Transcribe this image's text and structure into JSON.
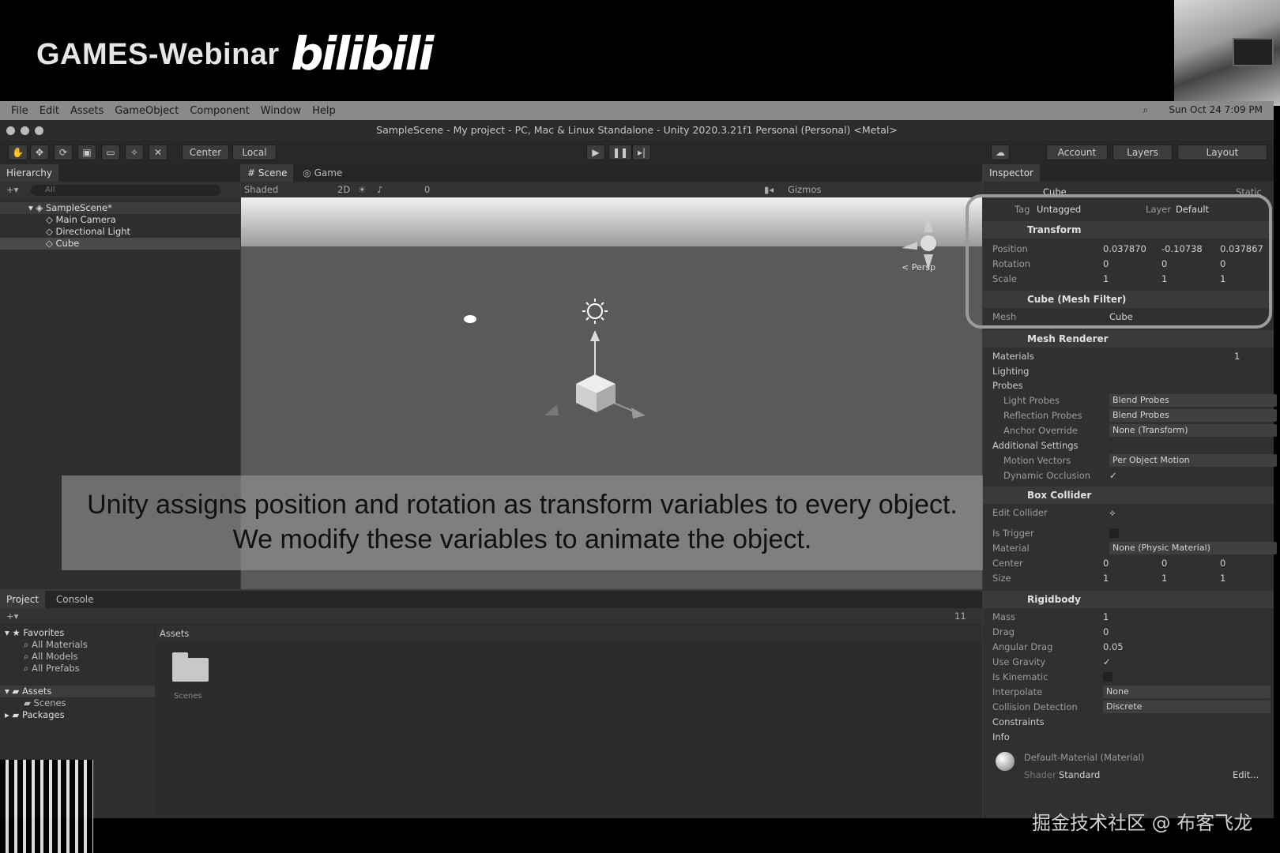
{
  "banner": {
    "brand": "GAMES-Webinar",
    "bili": "bilibili"
  },
  "menu": [
    "File",
    "Edit",
    "Assets",
    "GameObject",
    "Component",
    "Window",
    "Help"
  ],
  "clock": "Sun Oct 24  7:09 PM",
  "window_title": "SampleScene - My project - PC, Mac & Linux Standalone - Unity 2020.3.21f1 Personal (Personal) <Metal>",
  "toolbar": {
    "center": "Center",
    "local": "Local",
    "account": "Account",
    "layers": "Layers",
    "layout": "Layout"
  },
  "hierarchy": {
    "tab": "Hierarchy",
    "search": "All",
    "scene": "SampleScene*",
    "items": [
      "Main Camera",
      "Directional Light",
      "Cube"
    ]
  },
  "scene_view": {
    "tab_scene": "Scene",
    "tab_game": "Game",
    "shading": "Shaded",
    "dim": "2D",
    "gizmos": "Gizmos",
    "persp": "< Persp",
    "hidden_count": "0"
  },
  "inspector": {
    "tab": "Inspector",
    "object_name": "Cube",
    "static": "Static",
    "tag_label": "Tag",
    "tag": "Untagged",
    "layer_label": "Layer",
    "layer": "Default",
    "transform": {
      "title": "Transform",
      "position_label": "Position",
      "px": "0.037870",
      "py": "-0.10738",
      "pz": "0.037867",
      "rotation_label": "Rotation",
      "rx": "0",
      "ry": "0",
      "rz": "0",
      "scale_label": "Scale",
      "sx": "1",
      "sy": "1",
      "sz": "1"
    },
    "mesh_filter": {
      "title": "Cube (Mesh Filter)",
      "mesh_label": "Mesh",
      "mesh": "Cube"
    },
    "mesh_renderer": {
      "title": "Mesh Renderer",
      "materials": "Materials",
      "materials_count": "1",
      "lighting": "Lighting",
      "probes": "Probes",
      "light_probes_label": "Light Probes",
      "light_probes": "Blend Probes",
      "reflection_probes_label": "Reflection Probes",
      "reflection_probes": "Blend Probes",
      "anchor_label": "Anchor Override",
      "anchor": "None (Transform)",
      "additional": "Additional Settings",
      "motion_label": "Motion Vectors",
      "motion": "Per Object Motion",
      "occlusion_label": "Dynamic Occlusion"
    },
    "box_collider": {
      "title": "Box Collider",
      "edit_label": "Edit Collider",
      "trigger_label": "Is Trigger",
      "material_label": "Material",
      "material": "None (Physic Material)",
      "center_label": "Center",
      "cx": "0",
      "cy": "0",
      "cz": "0",
      "size_label": "Size",
      "zx": "1",
      "zy": "1",
      "zz": "1"
    },
    "rigidbody": {
      "title": "Rigidbody",
      "mass_label": "Mass",
      "mass": "1",
      "drag_label": "Drag",
      "drag": "0",
      "angdrag_label": "Angular Drag",
      "angdrag": "0.05",
      "gravity_label": "Use Gravity",
      "kinematic_label": "Is Kinematic",
      "interp_label": "Interpolate",
      "interp": "None",
      "collision_label": "Collision Detection",
      "collision": "Discrete",
      "constraints": "Constraints",
      "info": "Info"
    },
    "material": {
      "title": "Default-Material (Material)",
      "shader_label": "Shader",
      "shader": "Standard",
      "edit": "Edit..."
    }
  },
  "project": {
    "tab_project": "Project",
    "tab_console": "Console",
    "favorites": "Favorites",
    "fav_items": [
      "All Materials",
      "All Models",
      "All Prefabs"
    ],
    "assets": "Assets",
    "scenes": "Scenes",
    "packages": "Packages",
    "assets_header": "Assets",
    "folder": "Scenes",
    "count": "11"
  },
  "caption": {
    "line1": "Unity assigns position and rotation as transform variables to every object.",
    "line2": "We modify these variables to animate the object."
  },
  "watermark": "掘金技术社区 @ 布客飞龙"
}
